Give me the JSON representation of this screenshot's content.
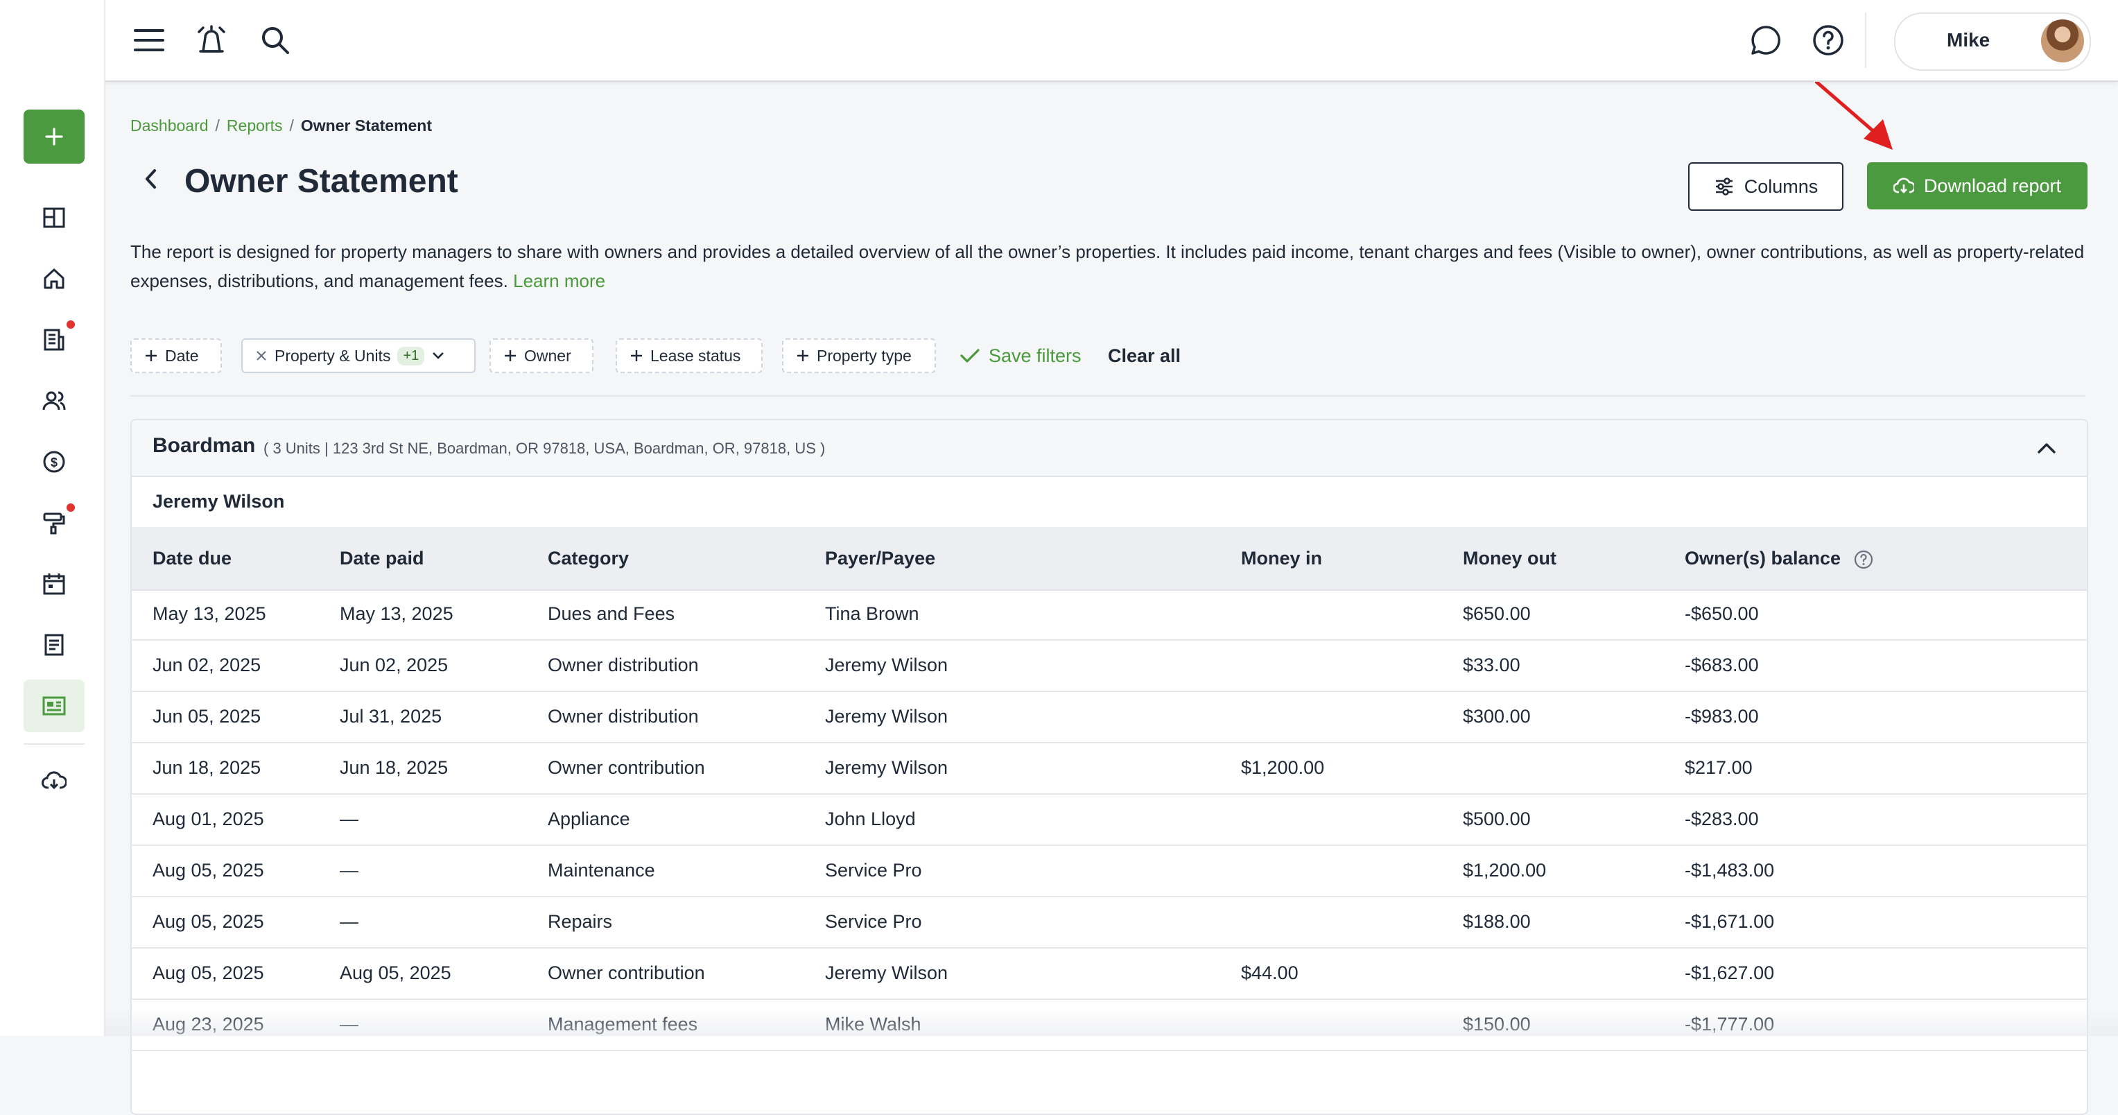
{
  "topbar": {
    "user_name": "Mike"
  },
  "breadcrumb": {
    "items": [
      "Dashboard",
      "Reports"
    ],
    "current": "Owner Statement",
    "separator": "/"
  },
  "page": {
    "title": "Owner Statement",
    "columns_label": "Columns",
    "download_label": "Download report",
    "description": "The report is designed for property managers to share with owners and provides a detailed overview of all the owner’s properties. It includes paid income, tenant charges and fees (Visible to owner), owner contributions, as well as property-related expenses, distributions, and management fees.",
    "learn_more": "Learn more"
  },
  "filters": {
    "date": "Date",
    "property_units": "Property & Units",
    "property_units_badge": "+1",
    "owner": "Owner",
    "lease_status": "Lease status",
    "property_type": "Property type",
    "save_filters": "Save filters",
    "clear_all": "Clear all"
  },
  "property": {
    "name": "Boardman",
    "meta": "( 3 Units | 123 3rd St NE, Boardman, OR 97818, USA, Boardman, OR, 97818, US )",
    "owner": "Jeremy Wilson"
  },
  "table": {
    "headers": [
      "Date due",
      "Date paid",
      "Category",
      "Payer/Payee",
      "Money in",
      "Money out",
      "Owner(s) balance"
    ],
    "rows": [
      [
        "May 13, 2025",
        "May 13, 2025",
        "Dues and Fees",
        "Tina Brown",
        "",
        "$650.00",
        "-$650.00"
      ],
      [
        "Jun 02, 2025",
        "Jun 02, 2025",
        "Owner distribution",
        "Jeremy Wilson",
        "",
        "$33.00",
        "-$683.00"
      ],
      [
        "Jun 05, 2025",
        "Jul 31, 2025",
        "Owner distribution",
        "Jeremy Wilson",
        "",
        "$300.00",
        "-$983.00"
      ],
      [
        "Jun 18, 2025",
        "Jun 18, 2025",
        "Owner contribution",
        "Jeremy Wilson",
        "$1,200.00",
        "",
        "$217.00"
      ],
      [
        "Aug 01, 2025",
        "—",
        "Appliance",
        "John Lloyd",
        "",
        "$500.00",
        "-$283.00"
      ],
      [
        "Aug 05, 2025",
        "—",
        "Maintenance",
        "Service Pro",
        "",
        "$1,200.00",
        "-$1,483.00"
      ],
      [
        "Aug 05, 2025",
        "—",
        "Repairs",
        "Service Pro",
        "",
        "$188.00",
        "-$1,671.00"
      ],
      [
        "Aug 05, 2025",
        "Aug 05, 2025",
        "Owner contribution",
        "Jeremy Wilson",
        "$44.00",
        "",
        "-$1,627.00"
      ],
      [
        "Aug 23, 2025",
        "—",
        "Management fees",
        "Mike Walsh",
        "",
        "$150.00",
        "-$1,777.00"
      ]
    ]
  },
  "icons": {
    "menu": "hamburger-icon",
    "alarm": "alarm-icon",
    "search": "search-icon",
    "chat": "chat-icon",
    "help": "help-icon",
    "download": "cloud-download-icon",
    "columns": "sliders-icon"
  },
  "colors": {
    "brand_green": "#4c9a3f",
    "link_green": "#4a9a3c",
    "alert_red": "#e0342f",
    "annotation_arrow": "#e02020"
  }
}
